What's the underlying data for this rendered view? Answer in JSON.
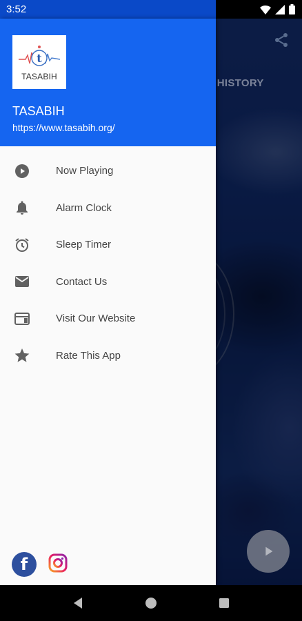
{
  "status_bar": {
    "time": "3:52"
  },
  "background_app": {
    "tab_label": "S HISTORY"
  },
  "drawer": {
    "logo_text": "TASABIH",
    "title": "TASABIH",
    "url": "https://www.tasabih.org/",
    "items": [
      {
        "label": "Now Playing",
        "icon": "play-circle-icon"
      },
      {
        "label": "Alarm Clock",
        "icon": "bell-icon"
      },
      {
        "label": "Sleep Timer",
        "icon": "alarm-clock-icon"
      },
      {
        "label": "Contact Us",
        "icon": "mail-icon"
      },
      {
        "label": "Visit Our Website",
        "icon": "web-icon"
      },
      {
        "label": "Rate This App",
        "icon": "star-icon"
      }
    ],
    "social": [
      "facebook-icon",
      "instagram-icon"
    ]
  },
  "colors": {
    "header_blue": "#1565f0",
    "status_blue": "#0a49c8",
    "icon_gray": "#616161",
    "label_gray": "#444444"
  }
}
